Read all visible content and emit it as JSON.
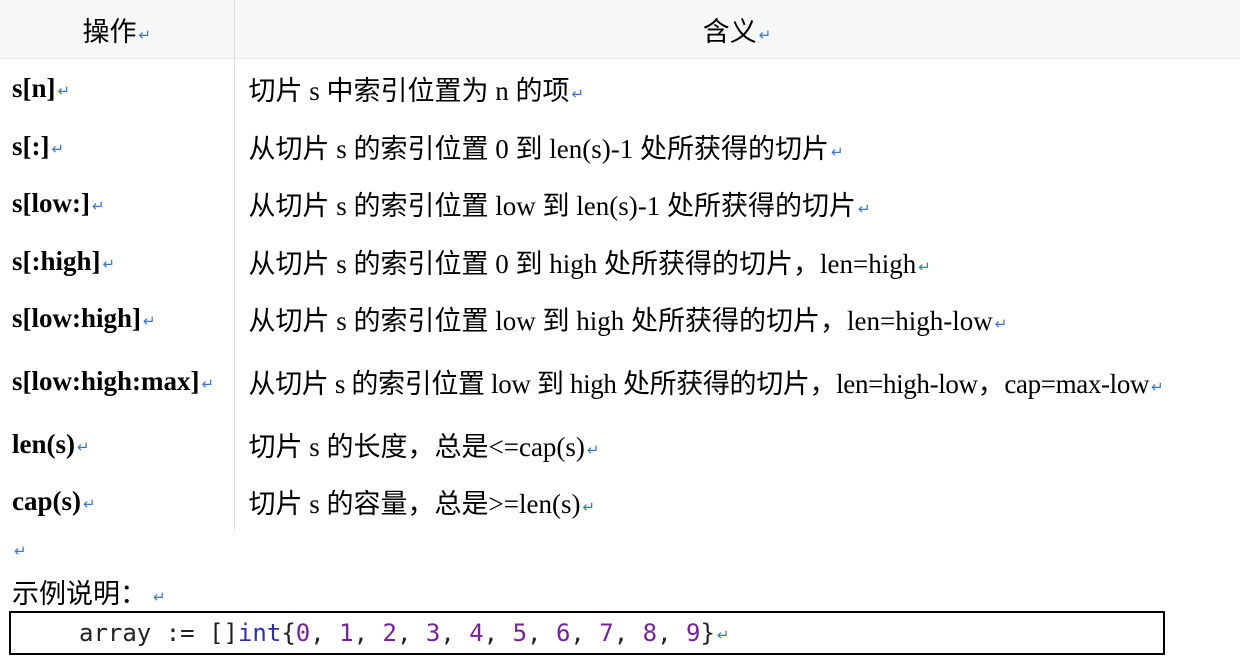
{
  "table": {
    "headers": [
      "操作",
      "含义"
    ],
    "rows": [
      {
        "op": "s[n]",
        "meaning": "切片 s 中索引位置为 n 的项"
      },
      {
        "op": "s[:]",
        "meaning": "从切片 s 的索引位置 0 到 len(s)-1 处所获得的切片"
      },
      {
        "op": "s[low:]",
        "meaning": "从切片 s 的索引位置 low 到 len(s)-1 处所获得的切片"
      },
      {
        "op": "s[:high]",
        "meaning": "从切片 s 的索引位置 0 到 high 处所获得的切片，len=high"
      },
      {
        "op": "s[low:high]",
        "meaning": "从切片 s 的索引位置 low 到 high 处所获得的切片，len=high-low"
      },
      {
        "op": "s[low:high:max]",
        "meaning": "从切片 s 的索引位置 low 到 high 处所获得的切片，len=high-low，cap=max-low"
      },
      {
        "op": "len(s)",
        "meaning": "切片 s 的长度，总是<=cap(s)"
      },
      {
        "op": "cap(s)",
        "meaning": "切片 s 的容量，总是>=len(s)"
      }
    ]
  },
  "paragraph_mark": "↵",
  "example_label": "示例说明：",
  "code": {
    "identifier": "array",
    "operator": ":=",
    "type_prefix": "[]",
    "keyword": "int",
    "values": [
      "0",
      "1",
      "2",
      "3",
      "4",
      "5",
      "6",
      "7",
      "8",
      "9"
    ]
  },
  "colors": {
    "paragraph_mark": "#3a78d8",
    "keyword": "#2d2db5",
    "number": "#7a1fa2",
    "header_bg": "#f7f7f7"
  }
}
